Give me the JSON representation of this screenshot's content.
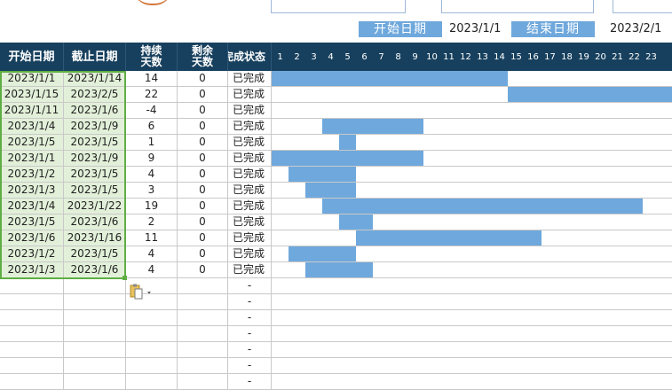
{
  "summary": {
    "start_label": "开始日期",
    "start_value": "2023/1/1",
    "end_label": "结束日期",
    "end_value": "2023/2/1"
  },
  "headers": {
    "start": "开始日期",
    "end": "截止日期",
    "duration": "持续天数",
    "remaining": "剩余天数",
    "status": "完成状态"
  },
  "day_ticks": [
    "1",
    "2",
    "3",
    "4",
    "5",
    "6",
    "7",
    "8",
    "9",
    "10",
    "11",
    "12",
    "13",
    "14",
    "15",
    "16",
    "17",
    "18",
    "19",
    "20",
    "21",
    "22",
    "23"
  ],
  "tasks": [
    {
      "start": "2023/1/1",
      "end": "2023/1/14",
      "duration": "14",
      "remaining": "0",
      "status": "已完成",
      "bar_start_day": 1,
      "bar_days": 14
    },
    {
      "start": "2023/1/15",
      "end": "2023/2/5",
      "duration": "22",
      "remaining": "0",
      "status": "已完成",
      "bar_start_day": 15,
      "bar_days": 22
    },
    {
      "start": "2023/1/11",
      "end": "2023/1/6",
      "duration": "-4",
      "remaining": "0",
      "status": "已完成",
      "bar_start_day": 11,
      "bar_days": 0
    },
    {
      "start": "2023/1/4",
      "end": "2023/1/9",
      "duration": "6",
      "remaining": "0",
      "status": "已完成",
      "bar_start_day": 4,
      "bar_days": 6
    },
    {
      "start": "2023/1/5",
      "end": "2023/1/5",
      "duration": "1",
      "remaining": "0",
      "status": "已完成",
      "bar_start_day": 5,
      "bar_days": 1
    },
    {
      "start": "2023/1/1",
      "end": "2023/1/9",
      "duration": "9",
      "remaining": "0",
      "status": "已完成",
      "bar_start_day": 1,
      "bar_days": 9
    },
    {
      "start": "2023/1/2",
      "end": "2023/1/5",
      "duration": "4",
      "remaining": "0",
      "status": "已完成",
      "bar_start_day": 2,
      "bar_days": 4
    },
    {
      "start": "2023/1/3",
      "end": "2023/1/5",
      "duration": "3",
      "remaining": "0",
      "status": "已完成",
      "bar_start_day": 3,
      "bar_days": 3
    },
    {
      "start": "2023/1/4",
      "end": "2023/1/22",
      "duration": "19",
      "remaining": "0",
      "status": "已完成",
      "bar_start_day": 4,
      "bar_days": 19
    },
    {
      "start": "2023/1/5",
      "end": "2023/1/6",
      "duration": "2",
      "remaining": "0",
      "status": "已完成",
      "bar_start_day": 5,
      "bar_days": 2
    },
    {
      "start": "2023/1/6",
      "end": "2023/1/16",
      "duration": "11",
      "remaining": "0",
      "status": "已完成",
      "bar_start_day": 6,
      "bar_days": 11
    },
    {
      "start": "2023/1/2",
      "end": "2023/1/5",
      "duration": "4",
      "remaining": "0",
      "status": "已完成",
      "bar_start_day": 2,
      "bar_days": 4
    },
    {
      "start": "2023/1/3",
      "end": "2023/1/6",
      "duration": "4",
      "remaining": "0",
      "status": "已完成",
      "bar_start_day": 3,
      "bar_days": 4
    }
  ],
  "empty_rows_status": "-",
  "empty_row_count": 7,
  "colors": {
    "header_bg": "#17405e",
    "bar": "#6fa8dc",
    "date_fill": "#e2f0d9",
    "selection": "#5fae44"
  },
  "icons": {
    "paste_options": "paste-clipboard-icon"
  }
}
